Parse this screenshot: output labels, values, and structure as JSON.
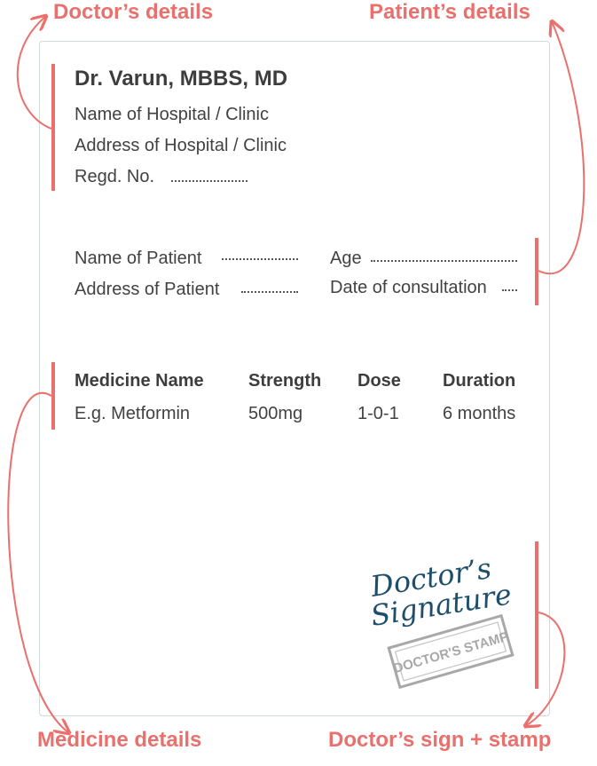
{
  "callouts": {
    "doctor_details": "Doctor’s details",
    "patient_details": "Patient’s details",
    "medicine_details": "Medicine details",
    "doctor_sign_stamp": "Doctor’s sign + stamp"
  },
  "doctor": {
    "name": "Dr. Varun, MBBS, MD",
    "hospital_name": "Name of Hospital / Clinic",
    "hospital_address": "Address of Hospital / Clinic",
    "regd_label": "Regd. No."
  },
  "patient": {
    "name_label": "Name of Patient",
    "address_label": "Address of Patient",
    "age_label": "Age",
    "date_label": "Date of consultation"
  },
  "medicine": {
    "headers": [
      "Medicine Name",
      "Strength",
      "Dose",
      "Duration"
    ],
    "rows": [
      [
        "E.g. Metformin",
        "500mg",
        "1-0-1",
        "6 months"
      ]
    ]
  },
  "signature": {
    "line1": "Doctor’s",
    "line2": "Signature",
    "stamp": "DOCTOR'S STAMP"
  },
  "colors": {
    "accent": "#e9706c",
    "text": "#424242",
    "border": "#cfdcdc",
    "signature_ink": "#1d4e6b",
    "stamp_gray": "#a8a8a8"
  }
}
